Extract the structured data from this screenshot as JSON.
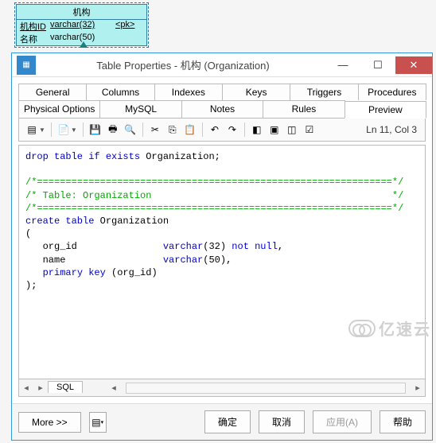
{
  "er": {
    "title": "机构",
    "rows": [
      {
        "col1": "机构ID",
        "col2": "varchar(32)",
        "col3": "<pk>"
      },
      {
        "col1": "名称",
        "col2": "varchar(50)",
        "col3": ""
      }
    ]
  },
  "dialog": {
    "title": "Table Properties - 机构 (Organization)",
    "tabs_row1": [
      "General",
      "Columns",
      "Indexes",
      "Keys",
      "Triggers",
      "Procedures"
    ],
    "tabs_row2": [
      "Physical Options",
      "MySQL",
      "Notes",
      "Rules",
      "Preview"
    ],
    "active_tab": "Preview",
    "status": "Ln 11, Col 3",
    "doc_tab": "SQL",
    "buttons": {
      "more": "More",
      "ok": "确定",
      "cancel": "取消",
      "apply": "应用(A)",
      "help": "帮助"
    }
  },
  "sql": {
    "l1_a": "drop table if exists",
    "l1_b": "Organization;",
    "l2": "/*==============================================================*/",
    "l3": "/* Table: Organization                                          */",
    "l4": "/*==============================================================*/",
    "l5_a": "create table",
    "l5_b": "Organization",
    "l6": "(",
    "l7_a": "org_id",
    "l7_b": "varchar",
    "l7_c": "(32)",
    "l7_d": "not null",
    "l8_a": "name",
    "l8_b": "varchar",
    "l8_c": "(50),",
    "l9_a": "primary key",
    "l9_b": "(org_id)",
    "l10": ");"
  },
  "watermark": "亿速云"
}
